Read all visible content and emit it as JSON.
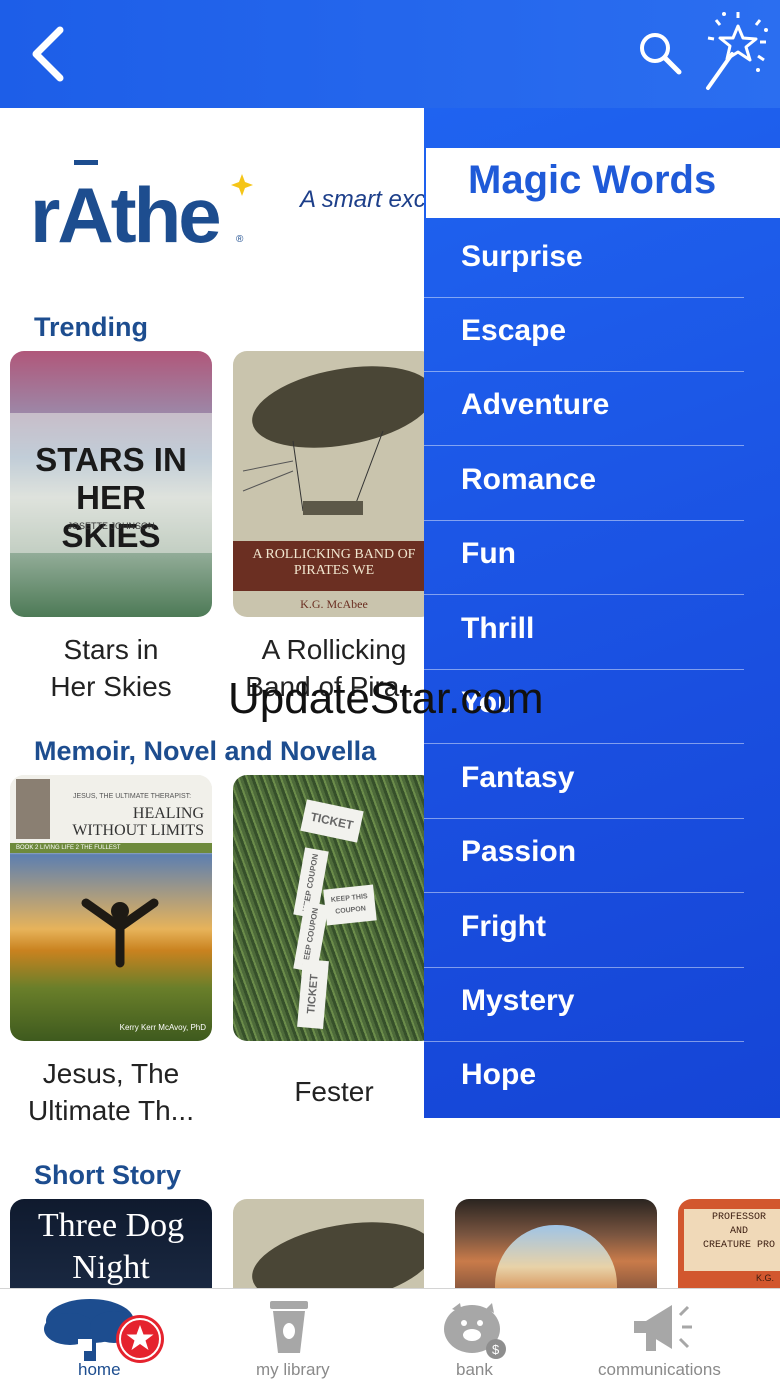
{
  "header": {
    "back_icon": "chevron-left-icon",
    "search_icon": "search-icon",
    "magic_icon": "magic-wand-icon"
  },
  "brand": {
    "logo_text": "rĀthe",
    "tagline": "A smart exc"
  },
  "sections": [
    {
      "title": "Trending",
      "books": [
        {
          "title_line1": "Stars in",
          "title_line2": "Her Skies",
          "cover_title": "STARS IN HER SKIES",
          "cover_author": "JOSETTE JOHNSON"
        },
        {
          "title_line1": "A Rollicking",
          "title_line2": "Band of Pira...",
          "cover_title": "A ROLLICKING BAND OF PIRATES WE",
          "cover_author": "K.G. McAbee"
        }
      ]
    },
    {
      "title": "Memoir, Novel and Novella",
      "books": [
        {
          "title_line1": "Jesus, The",
          "title_line2": "Ultimate Th...",
          "cover_subtitle": "JESUS, THE ULTIMATE THERAPIST:",
          "cover_title": "HEALING WITHOUT LIMITS",
          "cover_series": "BOOK 2   LIVING LIFE 2 THE FULLEST",
          "cover_author": "Kerry Kerr McAvoy, PhD"
        },
        {
          "title_line1": "Fester",
          "title_line2": "",
          "cover_ticket1": "TICKET",
          "cover_ticket2": "KEEP COUPON",
          "cover_ticket3": "KEEP THIS COUPON",
          "cover_ticket4": "KEEP COUPON",
          "cover_ticket5": "TICKET"
        }
      ]
    },
    {
      "title": "Short Story",
      "books": [
        {
          "cover_title": "Three Dog Night"
        },
        {
          "cover_title": ""
        },
        {
          "cover_title": ""
        },
        {
          "cover_title_line1": "PROFESSOR",
          "cover_title_line2": "AND",
          "cover_title_line3": "CREATURE PRO",
          "cover_author": "K.G."
        }
      ]
    }
  ],
  "magic_menu": {
    "title": "Magic Words",
    "items": [
      "Surprise",
      "Escape",
      "Adventure",
      "Romance",
      "Fun",
      "Thrill",
      "You",
      "Fantasy",
      "Passion",
      "Fright",
      "Mystery",
      "Hope"
    ]
  },
  "watermark": "UpdateStar.com",
  "tabs": [
    {
      "label": "home",
      "icon": "tree-house-icon",
      "active": true
    },
    {
      "label": "my library",
      "icon": "coffee-cup-icon",
      "active": false
    },
    {
      "label": "bank",
      "icon": "piggy-bank-icon",
      "active": false
    },
    {
      "label": "communications",
      "icon": "megaphone-icon",
      "active": false
    }
  ],
  "colors": {
    "brand_blue": "#1d5ee8",
    "section_title": "#1d4d8f",
    "menu_text": "#ffffff",
    "inactive_tab": "#8a8a8a"
  }
}
